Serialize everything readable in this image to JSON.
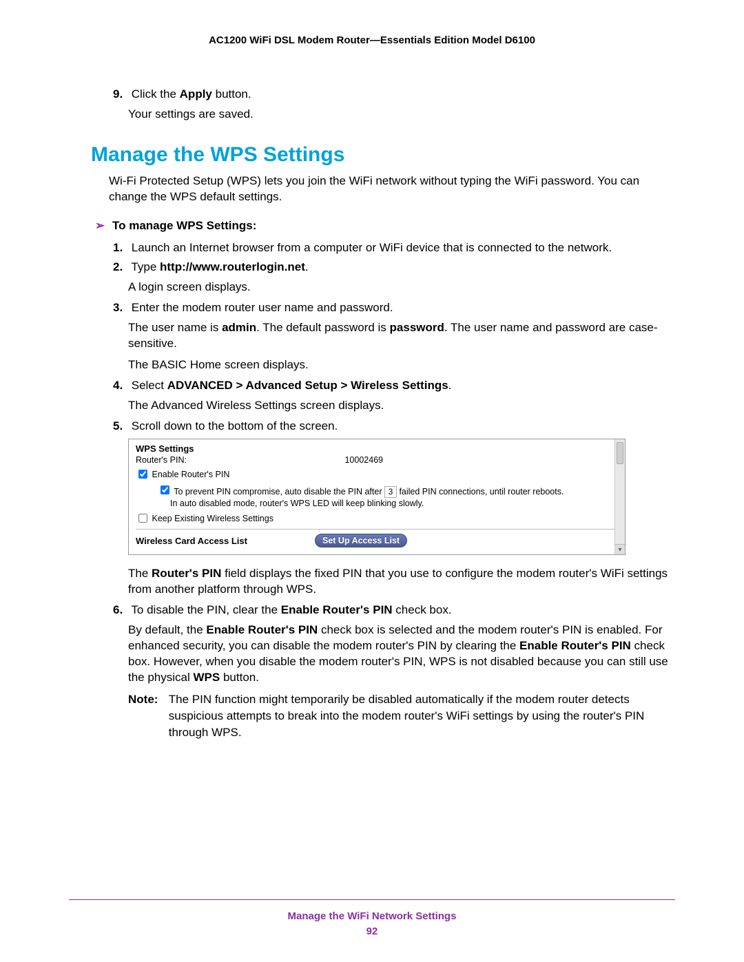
{
  "header": {
    "title": "AC1200 WiFi DSL Modem Router—Essentials Edition Model D6100"
  },
  "top": {
    "step9_num": "9.",
    "step9_a": "Click the ",
    "step9_b_bold": "Apply",
    "step9_c": " button.",
    "step9_sub": "Your settings are saved."
  },
  "section": {
    "heading": "Manage the WPS Settings",
    "intro": "Wi-Fi Protected Setup (WPS) lets you join the WiFi network without typing the WiFi password. You can change the WPS default settings.",
    "proc_head": "To manage WPS Settings:"
  },
  "steps": {
    "s1_num": "1.",
    "s1": "Launch an Internet browser from a computer or WiFi device that is connected to the network.",
    "s2_num": "2.",
    "s2_a": "Type ",
    "s2_b_bold": "http://www.routerlogin.net",
    "s2_c": ".",
    "s2_sub": "A login screen displays.",
    "s3_num": "3.",
    "s3": "Enter the modem router user name and password.",
    "s3_sub1_a": "The user name is ",
    "s3_sub1_b_bold": "admin",
    "s3_sub1_c": ". The default password is ",
    "s3_sub1_d_bold": "password",
    "s3_sub1_e": ". The user name and password are case-sensitive.",
    "s3_sub2": "The BASIC Home screen displays.",
    "s4_num": "4.",
    "s4_a": "Select ",
    "s4_b_bold": "ADVANCED > Advanced Setup > Wireless Settings",
    "s4_c": ".",
    "s4_sub": "The Advanced Wireless Settings screen displays.",
    "s5_num": "5.",
    "s5": "Scroll down to the bottom of the screen.",
    "s5_sub_a": "The ",
    "s5_sub_b_bold": "Router's PIN",
    "s5_sub_c": " field displays the fixed PIN that you use to configure the modem router's WiFi settings from another platform through WPS.",
    "s6_num": "6.",
    "s6_a": "To disable the PIN, clear the ",
    "s6_b_bold": "Enable Router's PIN",
    "s6_c": " check box.",
    "s6_sub_a": "By default, the ",
    "s6_sub_b_bold": "Enable Router's PIN",
    "s6_sub_c": " check box is selected and the modem router's PIN is enabled. For enhanced security, you can disable the modem router's PIN by clearing the ",
    "s6_sub_d_bold": "Enable Router's PIN",
    "s6_sub_e": " check box. However, when you disable the modem router's PIN, WPS is not disabled because you can still use the physical ",
    "s6_sub_f_bold": "WPS",
    "s6_sub_g": " button."
  },
  "note": {
    "label": "Note:",
    "text": "The PIN function might temporarily be disabled automatically if the modem router detects suspicious attempts to break into the modem router's WiFi settings by using the router's PIN through WPS."
  },
  "screenshot": {
    "title": "WPS Settings",
    "pin_label": "Router's PIN:",
    "pin_value": "10002469",
    "cb_enable": "Enable Router's PIN",
    "cb_prevent_a": "To prevent PIN compromise, auto disable the PIN after ",
    "cb_prevent_count": "3",
    "cb_prevent_b": " failed PIN connections, until router reboots.",
    "auto_note": "In auto disabled mode, router's WPS LED will keep blinking slowly.",
    "cb_keep": "Keep Existing Wireless Settings",
    "acl_label": "Wireless Card Access List",
    "acl_button": "Set Up Access List"
  },
  "footer": {
    "section_title": "Manage the WiFi Network Settings",
    "page_number": "92"
  }
}
